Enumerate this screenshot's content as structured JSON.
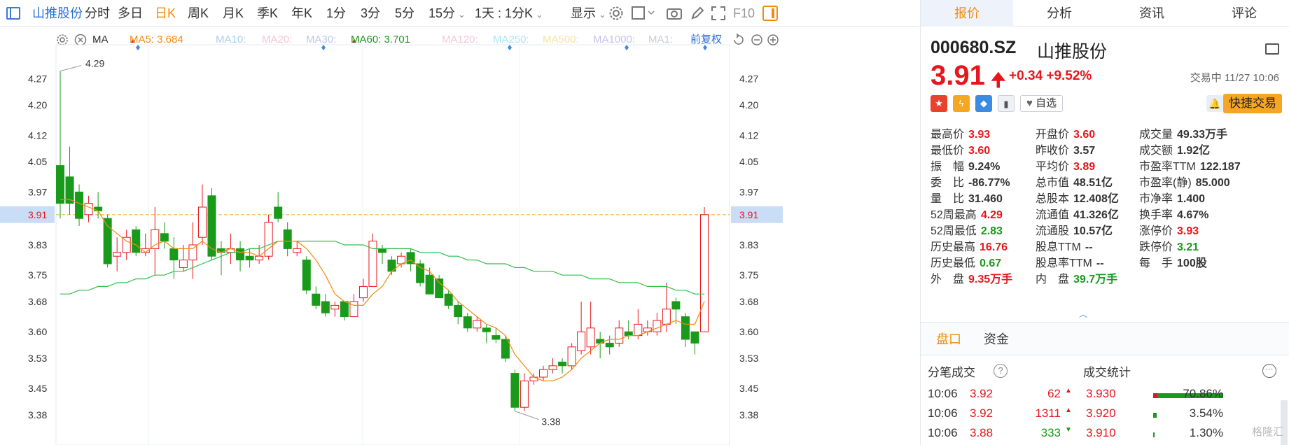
{
  "topbar": {
    "stock_name": "山推股份",
    "periods": [
      "分时",
      "多日",
      "日K",
      "周K",
      "月K",
      "季K",
      "年K",
      "1分",
      "3分",
      "5分",
      "15分"
    ],
    "active_period": "日K",
    "range_select": "1天 : 1分K",
    "display": "显示",
    "f10": "F10"
  },
  "ma": {
    "label": "MA",
    "ma5": "MA5: 3.684",
    "ma10": "MA10:",
    "ma20": "MA20:",
    "ma30": "MA30:",
    "ma60": "MA60: 3.701",
    "ma120": "MA120:",
    "ma250": "MA250:",
    "ma500": "MA500:",
    "ma1000": "MA1000:",
    "ma1": "MA1:",
    "adjust": "前复权"
  },
  "chart_data": {
    "type": "candlestick",
    "y_ticks": [
      "4.27",
      "4.20",
      "4.12",
      "4.05",
      "3.97",
      "3.91",
      "3.83",
      "3.75",
      "3.68",
      "3.60",
      "3.53",
      "3.45",
      "3.38"
    ],
    "ylim": [
      3.33,
      4.33
    ],
    "current_price_line": 3.91,
    "high_label": "4.29",
    "low_label": "3.38",
    "candles": [
      {
        "o": 4.04,
        "c": 3.94,
        "h": 4.29,
        "l": 3.9
      },
      {
        "o": 4.01,
        "c": 3.94,
        "h": 4.09,
        "l": 3.91
      },
      {
        "o": 3.97,
        "c": 3.9,
        "h": 3.99,
        "l": 3.88
      },
      {
        "o": 3.91,
        "c": 3.94,
        "h": 3.96,
        "l": 3.89
      },
      {
        "o": 3.93,
        "c": 3.92,
        "h": 3.97,
        "l": 3.9
      },
      {
        "o": 3.9,
        "c": 3.78,
        "h": 3.91,
        "l": 3.77
      },
      {
        "o": 3.8,
        "c": 3.81,
        "h": 3.85,
        "l": 3.76
      },
      {
        "o": 3.81,
        "c": 3.85,
        "h": 3.87,
        "l": 3.79
      },
      {
        "o": 3.87,
        "c": 3.81,
        "h": 3.88,
        "l": 3.8
      },
      {
        "o": 3.81,
        "c": 3.82,
        "h": 3.86,
        "l": 3.8
      },
      {
        "o": 3.82,
        "c": 3.87,
        "h": 3.93,
        "l": 3.75
      },
      {
        "o": 3.86,
        "c": 3.84,
        "h": 3.89,
        "l": 3.82
      },
      {
        "o": 3.82,
        "c": 3.79,
        "h": 3.85,
        "l": 3.74
      },
      {
        "o": 3.77,
        "c": 3.79,
        "h": 3.83,
        "l": 3.76
      },
      {
        "o": 3.79,
        "c": 3.83,
        "h": 3.89,
        "l": 3.74
      },
      {
        "o": 3.85,
        "c": 3.93,
        "h": 3.99,
        "l": 3.83
      },
      {
        "o": 3.96,
        "c": 3.8,
        "h": 3.98,
        "l": 3.79
      },
      {
        "o": 3.82,
        "c": 3.81,
        "h": 3.84,
        "l": 3.75
      },
      {
        "o": 3.81,
        "c": 3.82,
        "h": 3.86,
        "l": 3.78
      },
      {
        "o": 3.82,
        "c": 3.79,
        "h": 3.84,
        "l": 3.76
      },
      {
        "o": 3.8,
        "c": 3.79,
        "h": 3.82,
        "l": 3.77
      },
      {
        "o": 3.79,
        "c": 3.8,
        "h": 3.83,
        "l": 3.78
      },
      {
        "o": 3.8,
        "c": 3.89,
        "h": 3.91,
        "l": 3.79
      },
      {
        "o": 3.93,
        "c": 3.9,
        "h": 3.97,
        "l": 3.89
      },
      {
        "o": 3.87,
        "c": 3.82,
        "h": 3.89,
        "l": 3.8
      },
      {
        "o": 3.81,
        "c": 3.82,
        "h": 3.84,
        "l": 3.8
      },
      {
        "o": 3.79,
        "c": 3.71,
        "h": 3.8,
        "l": 3.7
      },
      {
        "o": 3.7,
        "c": 3.67,
        "h": 3.72,
        "l": 3.66
      },
      {
        "o": 3.68,
        "c": 3.65,
        "h": 3.7,
        "l": 3.64
      },
      {
        "o": 3.66,
        "c": 3.67,
        "h": 3.68,
        "l": 3.64
      },
      {
        "o": 3.68,
        "c": 3.64,
        "h": 3.68,
        "l": 3.63
      },
      {
        "o": 3.64,
        "c": 3.68,
        "h": 3.7,
        "l": 3.64
      },
      {
        "o": 3.69,
        "c": 3.72,
        "h": 3.74,
        "l": 3.68
      },
      {
        "o": 3.72,
        "c": 3.84,
        "h": 3.86,
        "l": 3.72
      },
      {
        "o": 3.82,
        "c": 3.81,
        "h": 3.83,
        "l": 3.78
      },
      {
        "o": 3.79,
        "c": 3.76,
        "h": 3.8,
        "l": 3.75
      },
      {
        "o": 3.78,
        "c": 3.8,
        "h": 3.81,
        "l": 3.77
      },
      {
        "o": 3.81,
        "c": 3.78,
        "h": 3.82,
        "l": 3.76
      },
      {
        "o": 3.78,
        "c": 3.73,
        "h": 3.79,
        "l": 3.72
      },
      {
        "o": 3.75,
        "c": 3.7,
        "h": 3.77,
        "l": 3.7
      },
      {
        "o": 3.74,
        "c": 3.69,
        "h": 3.75,
        "l": 3.69
      },
      {
        "o": 3.7,
        "c": 3.67,
        "h": 3.71,
        "l": 3.66
      },
      {
        "o": 3.67,
        "c": 3.64,
        "h": 3.68,
        "l": 3.62
      },
      {
        "o": 3.64,
        "c": 3.61,
        "h": 3.65,
        "l": 3.6
      },
      {
        "o": 3.61,
        "c": 3.63,
        "h": 3.64,
        "l": 3.6
      },
      {
        "o": 3.61,
        "c": 3.6,
        "h": 3.62,
        "l": 3.57
      },
      {
        "o": 3.59,
        "c": 3.58,
        "h": 3.61,
        "l": 3.57
      },
      {
        "o": 3.58,
        "c": 3.53,
        "h": 3.59,
        "l": 3.52
      },
      {
        "o": 3.49,
        "c": 3.4,
        "h": 3.5,
        "l": 3.39
      },
      {
        "o": 3.4,
        "c": 3.47,
        "h": 3.49,
        "l": 3.39
      },
      {
        "o": 3.47,
        "c": 3.48,
        "h": 3.49,
        "l": 3.46
      },
      {
        "o": 3.48,
        "c": 3.5,
        "h": 3.51,
        "l": 3.47
      },
      {
        "o": 3.5,
        "c": 3.51,
        "h": 3.53,
        "l": 3.49
      },
      {
        "o": 3.52,
        "c": 3.51,
        "h": 3.53,
        "l": 3.49
      },
      {
        "o": 3.51,
        "c": 3.56,
        "h": 3.57,
        "l": 3.5
      },
      {
        "o": 3.55,
        "c": 3.6,
        "h": 3.68,
        "l": 3.54
      },
      {
        "o": 3.56,
        "c": 3.61,
        "h": 3.68,
        "l": 3.54
      },
      {
        "o": 3.58,
        "c": 3.57,
        "h": 3.6,
        "l": 3.53
      },
      {
        "o": 3.57,
        "c": 3.56,
        "h": 3.59,
        "l": 3.54
      },
      {
        "o": 3.57,
        "c": 3.61,
        "h": 3.63,
        "l": 3.56
      },
      {
        "o": 3.6,
        "c": 3.59,
        "h": 3.63,
        "l": 3.58
      },
      {
        "o": 3.59,
        "c": 3.62,
        "h": 3.66,
        "l": 3.58
      },
      {
        "o": 3.6,
        "c": 3.61,
        "h": 3.63,
        "l": 3.59
      },
      {
        "o": 3.6,
        "c": 3.63,
        "h": 3.65,
        "l": 3.59
      },
      {
        "o": 3.62,
        "c": 3.66,
        "h": 3.73,
        "l": 3.6
      },
      {
        "o": 3.68,
        "c": 3.66,
        "h": 3.69,
        "l": 3.62
      },
      {
        "o": 3.64,
        "c": 3.58,
        "h": 3.65,
        "l": 3.56
      },
      {
        "o": 3.6,
        "c": 3.57,
        "h": 3.6,
        "l": 3.54
      },
      {
        "o": 3.6,
        "c": 3.91,
        "h": 3.93,
        "l": 3.6
      }
    ],
    "ma5": [
      3.95,
      3.95,
      3.94,
      3.93,
      3.92,
      3.88,
      3.86,
      3.84,
      3.83,
      3.81,
      3.83,
      3.84,
      3.82,
      3.82,
      3.82,
      3.84,
      3.82,
      3.81,
      3.82,
      3.81,
      3.81,
      3.8,
      3.82,
      3.84,
      3.84,
      3.84,
      3.82,
      3.79,
      3.75,
      3.7,
      3.68,
      3.67,
      3.67,
      3.7,
      3.72,
      3.76,
      3.78,
      3.79,
      3.77,
      3.76,
      3.73,
      3.71,
      3.68,
      3.66,
      3.64,
      3.62,
      3.61,
      3.59,
      3.54,
      3.51,
      3.48,
      3.47,
      3.47,
      3.48,
      3.5,
      3.53,
      3.55,
      3.57,
      3.58,
      3.58,
      3.59,
      3.59,
      3.6,
      3.61,
      3.62,
      3.63,
      3.62,
      3.62,
      3.68
    ],
    "ma60": [
      3.7,
      3.7,
      3.71,
      3.71,
      3.72,
      3.72,
      3.73,
      3.73,
      3.74,
      3.74,
      3.75,
      3.75,
      3.76,
      3.76,
      3.77,
      3.78,
      3.79,
      3.8,
      3.81,
      3.81,
      3.82,
      3.82,
      3.83,
      3.84,
      3.84,
      3.84,
      3.84,
      3.84,
      3.84,
      3.84,
      3.83,
      3.83,
      3.83,
      3.82,
      3.82,
      3.82,
      3.82,
      3.82,
      3.81,
      3.81,
      3.81,
      3.8,
      3.8,
      3.79,
      3.79,
      3.78,
      3.78,
      3.78,
      3.77,
      3.77,
      3.76,
      3.76,
      3.76,
      3.75,
      3.75,
      3.75,
      3.74,
      3.74,
      3.74,
      3.73,
      3.73,
      3.73,
      3.72,
      3.72,
      3.72,
      3.71,
      3.71,
      3.7,
      3.7
    ]
  },
  "panel": {
    "tabs": [
      "报价",
      "分析",
      "资讯",
      "评论"
    ],
    "code": "000680.SZ",
    "name": "山推股份",
    "price": "3.91",
    "change": "+0.34",
    "change_pct": "+9.52%",
    "trade_time": "交易中 11/27 10:06",
    "zixuan": "自选",
    "quick_trade": "快捷交易",
    "quotes": [
      [
        {
          "label": "最高价",
          "value": "3.93",
          "color": "red"
        },
        {
          "label": "开盘价",
          "value": "3.60",
          "color": "red"
        },
        {
          "label": "成交量",
          "value": "49.33万手",
          "color": "dark"
        }
      ],
      [
        {
          "label": "最低价",
          "value": "3.60",
          "color": "red"
        },
        {
          "label": "昨收价",
          "value": "3.57",
          "color": "dark"
        },
        {
          "label": "成交额",
          "value": "1.92亿",
          "color": "dark"
        }
      ],
      [
        {
          "label": "振　幅",
          "value": "9.24%",
          "color": "dark"
        },
        {
          "label": "平均价",
          "value": "3.89",
          "color": "red"
        },
        {
          "label": "市盈率TTM",
          "value": "122.187",
          "color": "dark"
        }
      ],
      [
        {
          "label": "委　比",
          "value": "-86.77%",
          "color": "dark"
        },
        {
          "label": "总市值",
          "value": "48.51亿",
          "color": "dark"
        },
        {
          "label": "市盈率(静)",
          "value": "85.000",
          "color": "dark"
        }
      ],
      [
        {
          "label": "量　比",
          "value": "31.460",
          "color": "dark"
        },
        {
          "label": "总股本",
          "value": "12.408亿",
          "color": "dark"
        },
        {
          "label": "市净率",
          "value": "1.400",
          "color": "dark"
        }
      ],
      [
        {
          "label": "52周最高",
          "value": "4.29",
          "color": "red"
        },
        {
          "label": "流通值",
          "value": "41.326亿",
          "color": "dark"
        },
        {
          "label": "换手率",
          "value": "4.67%",
          "color": "dark"
        }
      ],
      [
        {
          "label": "52周最低",
          "value": "2.83",
          "color": "green"
        },
        {
          "label": "流通股",
          "value": "10.57亿",
          "color": "dark"
        },
        {
          "label": "涨停价",
          "value": "3.93",
          "color": "red"
        }
      ],
      [
        {
          "label": "历史最高",
          "value": "16.76",
          "color": "red"
        },
        {
          "label": "股息TTM",
          "value": "--",
          "color": "dark"
        },
        {
          "label": "跌停价",
          "value": "3.21",
          "color": "green"
        }
      ],
      [
        {
          "label": "历史最低",
          "value": "0.67",
          "color": "green"
        },
        {
          "label": "股息率TTM",
          "value": "--",
          "color": "dark"
        },
        {
          "label": "每　手",
          "value": "100股",
          "color": "dark"
        }
      ],
      [
        {
          "label": "外　盘",
          "value": "9.35万手",
          "color": "red"
        },
        {
          "label": "内　盘",
          "value": "39.7万手",
          "color": "green"
        }
      ]
    ],
    "subtabs": [
      "盘口",
      "资金"
    ],
    "ticks_title": "分笔成交",
    "stats_title": "成交统计",
    "ticks": [
      {
        "time": "10:06",
        "price": "3.92",
        "vol": "62",
        "dir": "up",
        "sprice": "3.930",
        "pct": "70.86%"
      },
      {
        "time": "10:06",
        "price": "3.92",
        "vol": "1311",
        "dir": "up",
        "sprice": "3.920",
        "pct": "3.54%"
      },
      {
        "time": "10:06",
        "price": "3.88",
        "vol": "333",
        "dir": "down",
        "sprice": "3.910",
        "pct": "1.30%"
      }
    ],
    "watermark": "格隆汇"
  },
  "colors": {
    "up": "#e8161c",
    "down": "#1a9a1a",
    "accent": "#f08a10",
    "ma5": "#f08a10",
    "ma60": "#2fbf4a"
  }
}
